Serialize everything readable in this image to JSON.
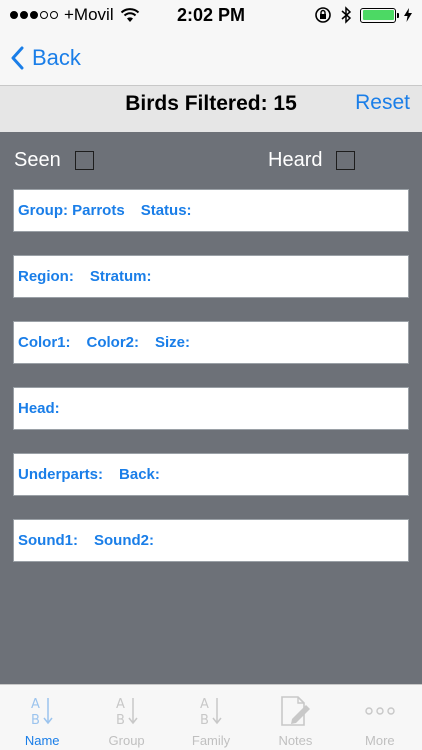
{
  "status_bar": {
    "carrier": "+Movil",
    "time": "2:02 PM"
  },
  "nav": {
    "back_label": "Back"
  },
  "filter": {
    "title": "Birds Filtered: 15",
    "reset_label": "Reset",
    "seen_label": "Seen",
    "heard_label": "Heard",
    "seen_checked": false,
    "heard_checked": false
  },
  "rows": [
    {
      "items": [
        "Group: Parrots",
        "Status:"
      ]
    },
    {
      "items": [
        "Region:",
        "Stratum:"
      ]
    },
    {
      "items": [
        "Color1:",
        "Color2:",
        "Size:"
      ]
    },
    {
      "items": [
        "Head:"
      ]
    },
    {
      "items": [
        "Underparts:",
        "Back:"
      ]
    },
    {
      "items": [
        "Sound1:",
        "Sound2:"
      ]
    }
  ],
  "tabs": [
    {
      "label": "Name",
      "icon": "sort-ab-icon",
      "active": true
    },
    {
      "label": "Group",
      "icon": "sort-ab-icon",
      "active": false
    },
    {
      "label": "Family",
      "icon": "sort-ab-icon",
      "active": false
    },
    {
      "label": "Notes",
      "icon": "notes-pencil-icon",
      "active": false
    },
    {
      "label": "More",
      "icon": "more-dots-icon",
      "active": false
    }
  ],
  "colors": {
    "accent": "#1a7ee8",
    "background": "#6d7178",
    "battery": "#4cd964"
  }
}
